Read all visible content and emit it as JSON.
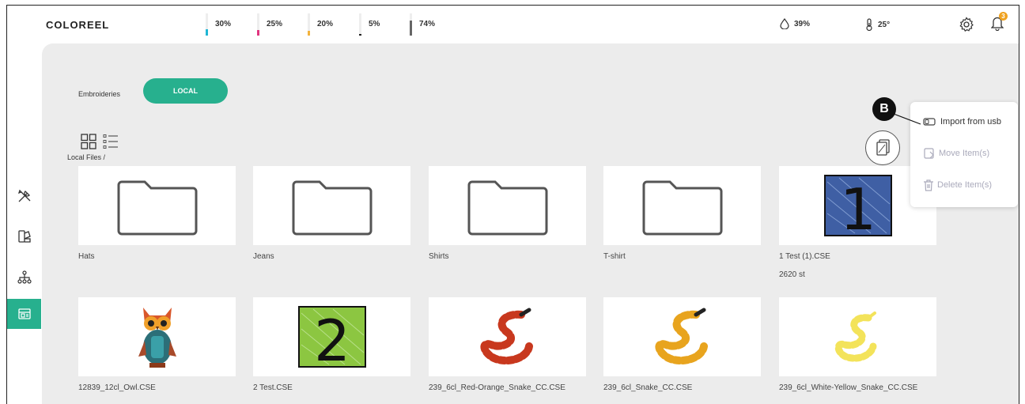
{
  "app": {
    "logo": "COLOREEL"
  },
  "inks": [
    {
      "label": "30%",
      "level": 0.3,
      "color": "#1fb6d4"
    },
    {
      "label": "25%",
      "level": 0.25,
      "color": "#e0357f"
    },
    {
      "label": "20%",
      "level": 0.2,
      "color": "#f3b33d"
    },
    {
      "label": "5%",
      "level": 0.05,
      "color": "#222222"
    },
    {
      "label": "74%",
      "level": 0.74,
      "color": "#666666"
    }
  ],
  "environment": {
    "humidity": "39%",
    "temperature": "25°"
  },
  "notifications": {
    "count": "3"
  },
  "header": {
    "section": "Embroideries",
    "local_button": "LOCAL"
  },
  "path": "Local Files /",
  "folders": [
    {
      "name": "Hats"
    },
    {
      "name": "Jeans"
    },
    {
      "name": "Shirts"
    },
    {
      "name": "T-shirt"
    }
  ],
  "files_row1": [
    {
      "name": "1 Test (1).CSE",
      "stitches": "2620 st"
    }
  ],
  "files_row2": [
    {
      "name": "12839_12cl_Owl.CSE"
    },
    {
      "name": "2 Test.CSE"
    },
    {
      "name": "239_6cl_Red-Orange_Snake_CC.CSE"
    },
    {
      "name": "239_6cl_Snake_CC.CSE"
    },
    {
      "name": "239_6cl_White-Yellow_Snake_CC.CSE"
    }
  ],
  "context_menu": {
    "import": "Import from usb",
    "move": "Move Item(s)",
    "delete": "Delete Item(s)"
  },
  "callout": "B",
  "colors": {
    "accent": "#27b08e",
    "badge": "#f0a21f"
  }
}
